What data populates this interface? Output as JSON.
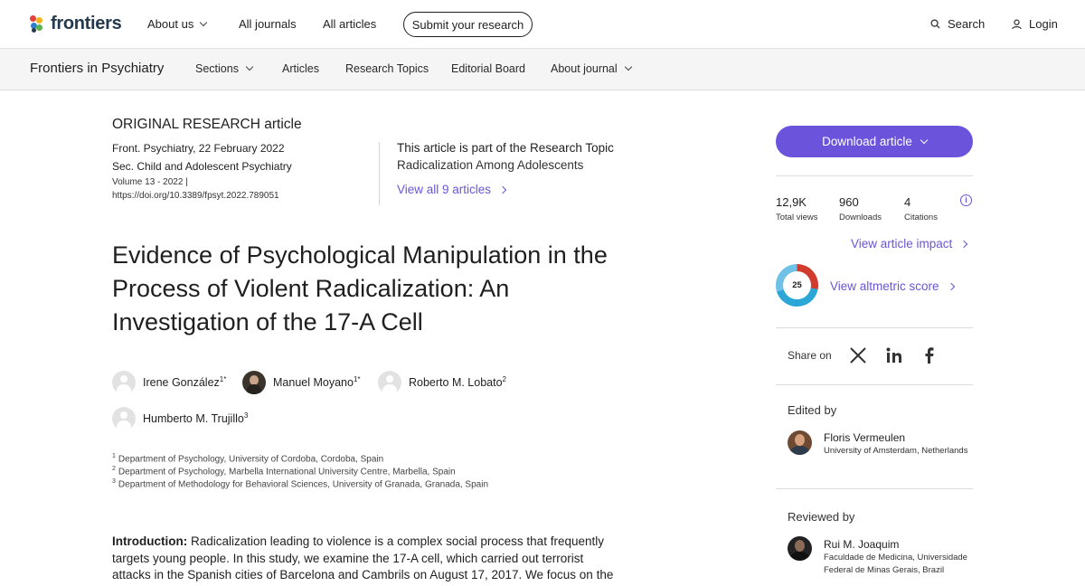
{
  "brand": {
    "name": "frontiers",
    "colors": [
      "#e5413c",
      "#f6b21a",
      "#2f7fd1",
      "#59b34c"
    ]
  },
  "topnav": {
    "about_us": "About us",
    "all_journals": "All journals",
    "all_articles": "All articles",
    "submit": "Submit your research",
    "search": "Search",
    "login": "Login"
  },
  "journalnav": {
    "title": "Frontiers in Psychiatry",
    "sections": "Sections",
    "articles": "Articles",
    "research_topics": "Research Topics",
    "editorial_board": "Editorial Board",
    "about_journal": "About journal"
  },
  "article": {
    "type": "ORIGINAL RESEARCH article",
    "journal_date": "Front. Psychiatry, 22 February 2022",
    "section": "Sec. Child and Adolescent Psychiatry",
    "volume": "Volume 13 - 2022 |",
    "doi": "https://doi.org/10.3389/fpsyt.2022.789051",
    "research_topic_label": "This article is part of the Research Topic",
    "research_topic_name": "Radicalization Among Adolescents",
    "view_all": "View all 9 articles",
    "title": "Evidence of Psychological Manipulation in the Process of Violent Radicalization: An Investigation of the 17-A Cell",
    "authors": [
      {
        "name": "Irene González",
        "sup": "1*"
      },
      {
        "name": "Manuel Moyano",
        "sup": "1*"
      },
      {
        "name": "Roberto M. Lobato",
        "sup": "2"
      },
      {
        "name": "Humberto M. Trujillo",
        "sup": "3"
      }
    ],
    "affiliations": [
      {
        "num": "1",
        "text": "Department of Psychology, University of Cordoba, Cordoba, Spain"
      },
      {
        "num": "2",
        "text": "Department of Psychology, Marbella International University Centre, Marbella, Spain"
      },
      {
        "num": "3",
        "text": "Department of Methodology for Behavioral Sciences, University of Granada, Granada, Spain"
      }
    ],
    "abstract_head": "Introduction:",
    "abstract_text": " Radicalization leading to violence is a complex social process that frequently targets young people. In this study, we examine the 17-A cell, which carried out terrorist attacks in the Spanish cities of Barcelona and Cambrils on August 17, 2017. We focus on the"
  },
  "sidebar": {
    "download": "Download article",
    "stats": [
      {
        "value": "12,9K",
        "label": "Total views"
      },
      {
        "value": "960",
        "label": "Downloads"
      },
      {
        "value": "4",
        "label": "Citations"
      }
    ],
    "impact_link": "View article impact",
    "altmetric_score": "25",
    "altmetric_link": "View altmetric score",
    "share_label": "Share on",
    "share_icons": [
      "x-icon",
      "linkedin-icon",
      "facebook-icon"
    ],
    "edited_by": "Edited by",
    "editor": {
      "name": "Floris Vermeulen",
      "aff": "University of Amsterdam, Netherlands"
    },
    "reviewed_by": "Reviewed by",
    "reviewer": {
      "name": "Rui M. Joaquim",
      "aff": "Faculdade de Medicina, Universidade Federal de Minas Gerais, Brazil"
    }
  },
  "colors": {
    "accent": "#6b53dc"
  }
}
